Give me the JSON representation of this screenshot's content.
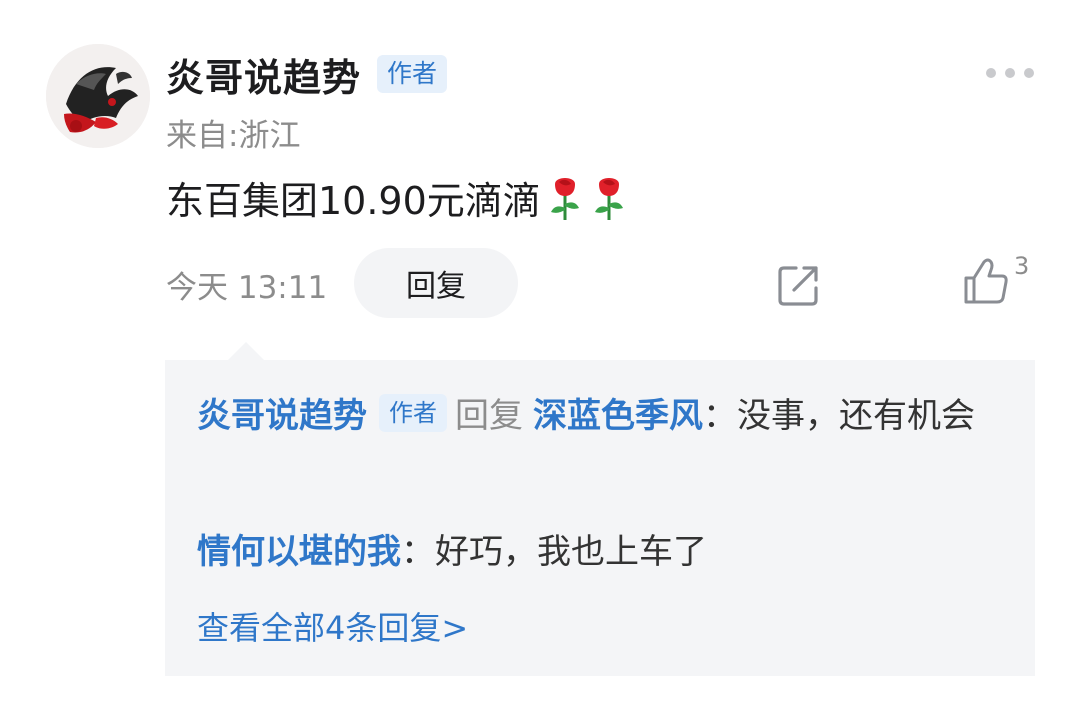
{
  "post": {
    "author": "炎哥说趋势",
    "author_badge": "作者",
    "location": "来自:浙江",
    "content": "东百集团10.90元滴滴",
    "emoji": "rose",
    "time": "今天 13:11",
    "reply_button": "回复",
    "likes": "3"
  },
  "replies": {
    "items": [
      {
        "author": "炎哥说趋势",
        "badge": "作者",
        "reply_word": "回复",
        "reply_to": "深蓝色季风",
        "text": "：没事，还有机会"
      },
      {
        "author": "情何以堪的我",
        "text": "：好巧，我也上车了"
      }
    ],
    "view_all": "查看全部4条回复>"
  },
  "colors": {
    "accent": "#2f77c9",
    "badge_bg": "#e6f0fb",
    "muted_text": "#8c8c8c",
    "reply_bg": "#f4f5f7"
  },
  "icons": [
    "more-icon",
    "share-icon",
    "like-icon",
    "rose-emoji-icon"
  ]
}
